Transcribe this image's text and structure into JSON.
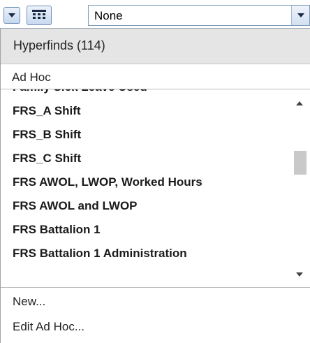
{
  "toolbar": {
    "filter_select_value": "None",
    "icons": {
      "mini_dropdown": "chevron-down-icon",
      "grid_button": "table-grid-icon",
      "select_arrow": "chevron-down-icon"
    }
  },
  "panel": {
    "title": "Hyperfinds (114)",
    "adhoc_label": "Ad Hoc",
    "items": [
      "Family Sick Leave Used",
      "FRS_A Shift",
      "FRS_B Shift",
      "FRS_C Shift",
      "FRS AWOL, LWOP, Worked Hours",
      "FRS AWOL and LWOP",
      "FRS Battalion 1",
      "FRS Battalion 1 Administration"
    ],
    "footer": {
      "new_label": "New...",
      "edit_label": "Edit Ad Hoc..."
    }
  },
  "colors": {
    "header_bg": "#e5e5e5",
    "button_border": "#6f8fb8",
    "thumb": "#c9c9c9"
  }
}
